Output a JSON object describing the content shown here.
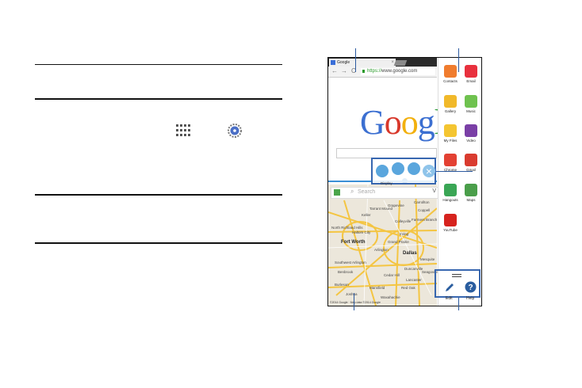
{
  "browser": {
    "tab_title": "Google",
    "tab_close": "×",
    "nav_back": "←",
    "nav_forward": "→",
    "nav_reload": "C",
    "url_scheme": "https://",
    "url_host": "www.google.com",
    "google_logo_letters": [
      "G",
      "o",
      "o",
      "g",
      "l"
    ],
    "google_logo_colors": [
      "#3b6fd1",
      "#d8382b",
      "#f2b00e",
      "#3b6fd1",
      "#2b9b3a"
    ]
  },
  "controls": {
    "label": "Display",
    "buttons": [
      "switch-windows",
      "drag-content",
      "full-screen",
      "close"
    ]
  },
  "maps": {
    "search_placeholder": "Search",
    "overflow": "V",
    "cities": [
      "Tarrant Mound",
      "Keller",
      "Colleyville",
      "Grapevine",
      "Coppell",
      "Carrollton",
      "North Richland Hills",
      "Farmers Branch",
      "Haltom City",
      "Irving",
      "Fort Worth",
      "Grand Prairie",
      "Arlington",
      "Dallas",
      "Mesquite",
      "Southwest Arlington",
      "Duncanville",
      "Benbrook",
      "Cedar Hill",
      "Lancaster",
      "Burleson",
      "Mansfield",
      "Joshua",
      "Waxahachie",
      "Red Oak",
      "Seagoville"
    ],
    "credit": "©2014 Google · Map data ©2014 Google"
  },
  "tray": {
    "apps": [
      {
        "label": "Contacts",
        "icon": "contacts-icon",
        "color": "#f07c2e"
      },
      {
        "label": "Email",
        "icon": "email-icon",
        "color": "#e8303d"
      },
      {
        "label": "Gallery",
        "icon": "gallery-icon",
        "color": "#f1b92a"
      },
      {
        "label": "Music",
        "icon": "music-icon",
        "color": "#6fc24f"
      },
      {
        "label": "My Files",
        "icon": "folder-icon",
        "color": "#f4c531"
      },
      {
        "label": "Video",
        "icon": "video-icon",
        "color": "#7a3fa6"
      },
      {
        "label": "Chrome",
        "icon": "chrome-icon",
        "color": "#e34133"
      },
      {
        "label": "Gmail",
        "icon": "gmail-icon",
        "color": "#d93b2f"
      },
      {
        "label": "Hangouts",
        "icon": "hangouts-icon",
        "color": "#3aa655"
      },
      {
        "label": "Maps",
        "icon": "maps-icon",
        "color": "#4a9e4a"
      },
      {
        "label": "YouTube",
        "icon": "youtube-icon",
        "color": "#d6231e"
      }
    ],
    "edit_label": "Edit",
    "help_label": "Help"
  }
}
